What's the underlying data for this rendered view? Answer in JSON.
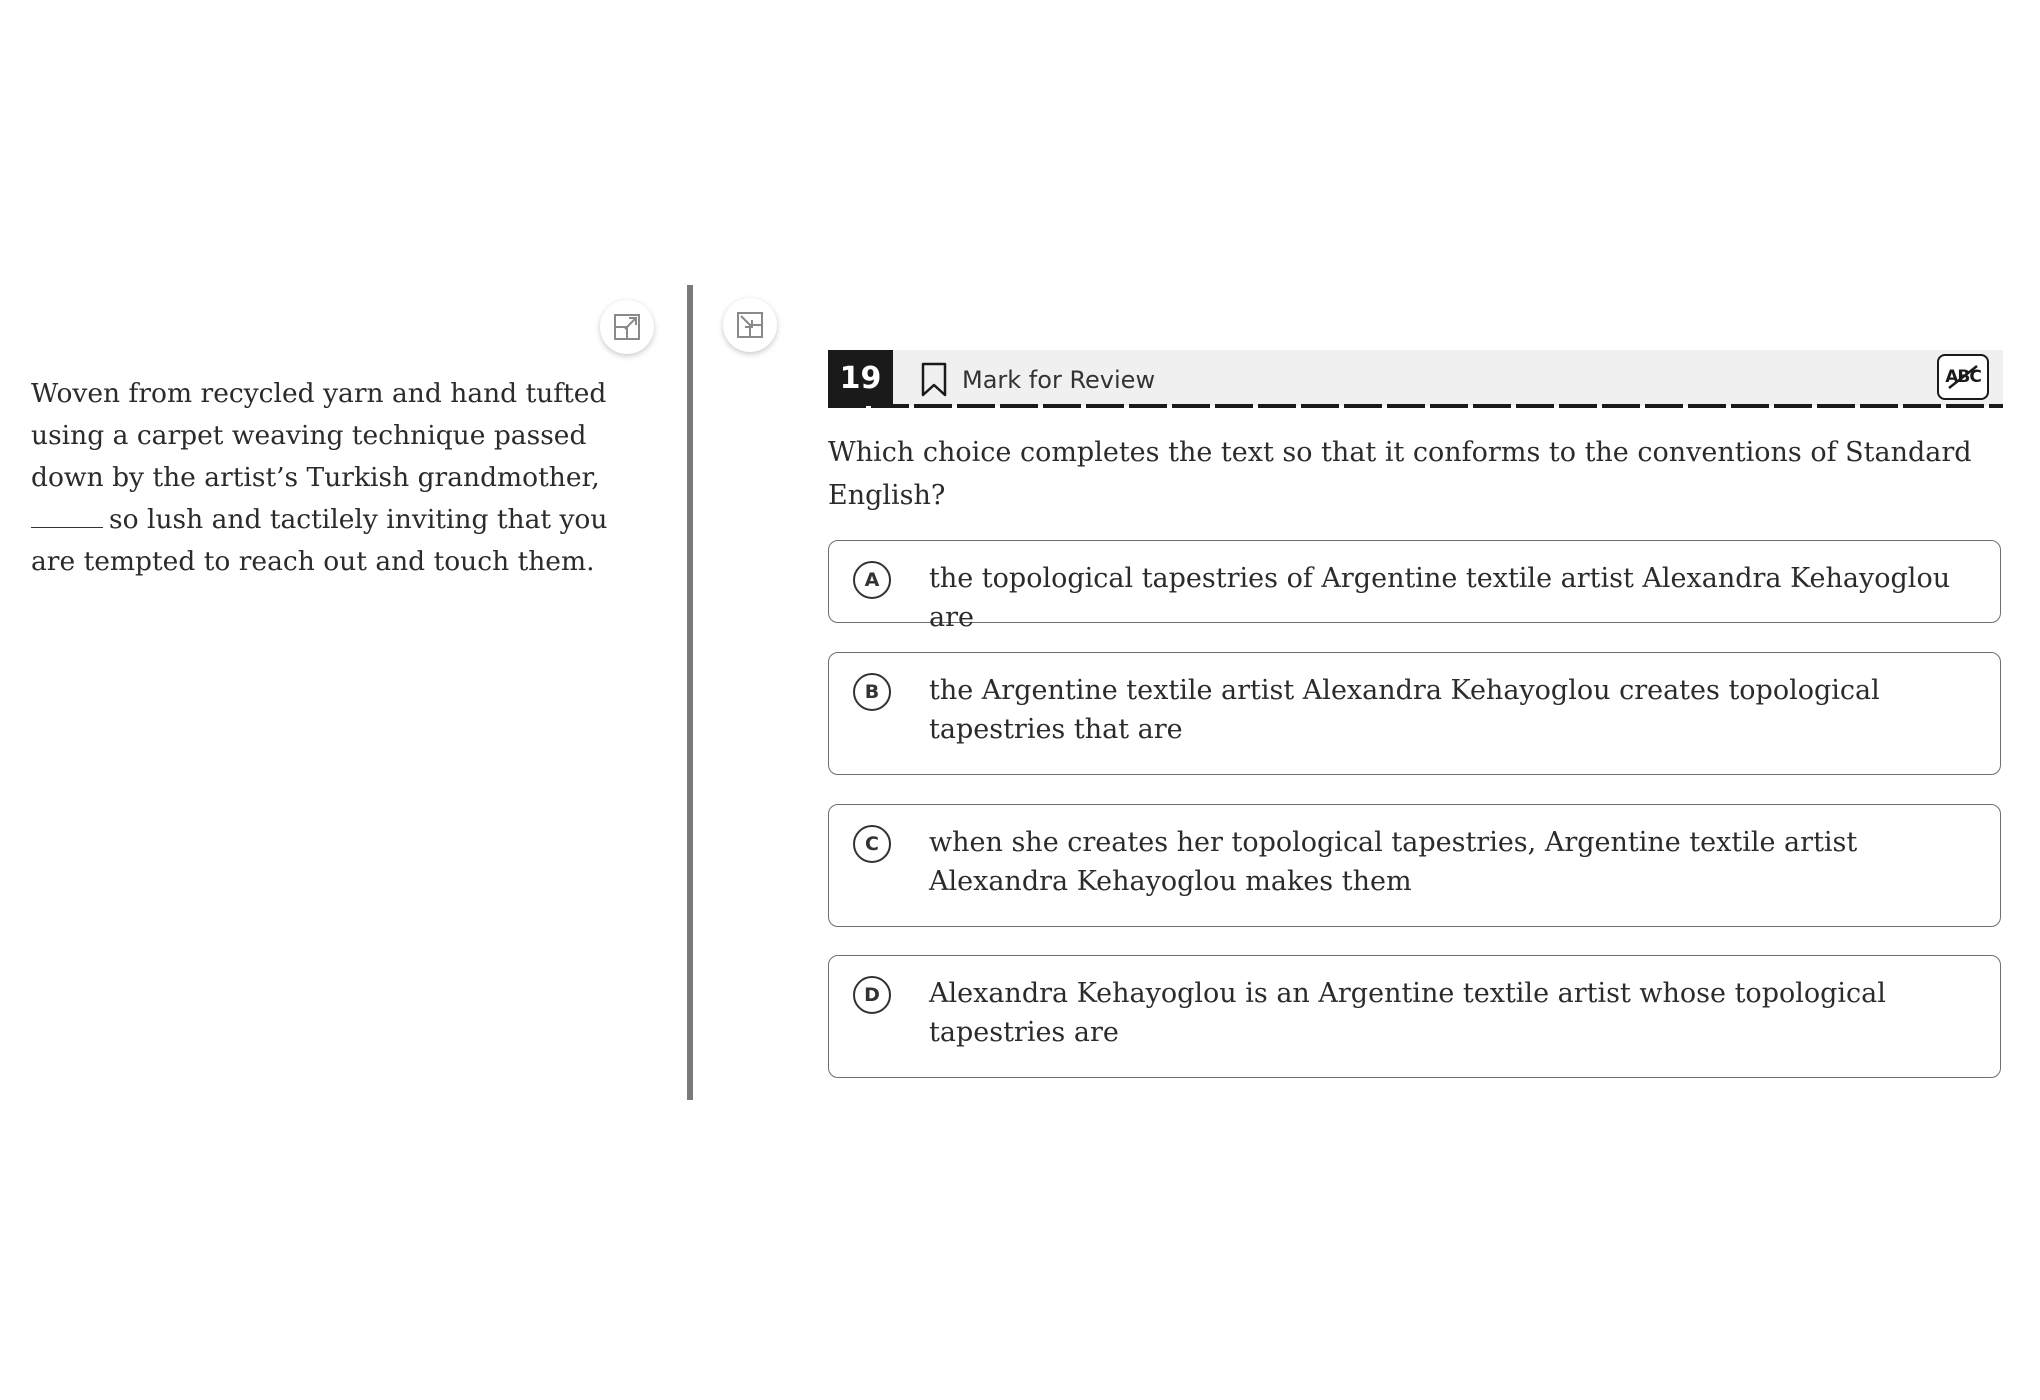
{
  "passage": {
    "text_before_blank": "Woven from recycled yarn and hand tufted using a carpet weaving technique passed down by the artist’s Turkish grandmother,",
    "text_after_blank": "so lush and tactilely inviting that you are tempted to reach out and touch them."
  },
  "header": {
    "question_number": "19",
    "mark_for_review_label": "Mark for Review",
    "abc_label": "ABC"
  },
  "question": {
    "prompt": "Which choice completes the text so that it conforms to the conventions of Standard English?"
  },
  "choices": [
    {
      "letter": "A",
      "text": "the topological tapestries of Argentine textile artist Alexandra Kehayoglou are"
    },
    {
      "letter": "B",
      "text": "the Argentine textile artist Alexandra Kehayoglou creates topological tapestries that are"
    },
    {
      "letter": "C",
      "text": "when she creates her topological tapestries, Argentine textile artist Alexandra Kehayoglou makes them"
    },
    {
      "letter": "D",
      "text": "Alexandra Kehayoglou is an Argentine textile artist whose topological tapestries are"
    }
  ],
  "colors": {
    "header_background": "#f0f0f0",
    "question_number_background": "#1a1a1a",
    "divider": "#7a7a7a",
    "choice_border": "#6f6f6f"
  },
  "icons": {
    "expand": "expand-icon",
    "collapse": "collapse-icon",
    "bookmark": "bookmark-icon",
    "eliminator": "abc-strikethrough-icon"
  }
}
